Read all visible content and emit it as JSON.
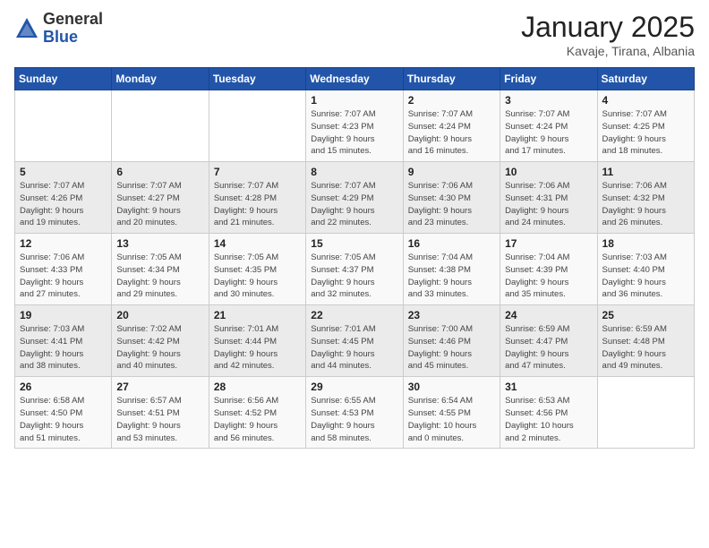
{
  "logo": {
    "general": "General",
    "blue": "Blue"
  },
  "header": {
    "month": "January 2025",
    "location": "Kavaje, Tirana, Albania"
  },
  "weekdays": [
    "Sunday",
    "Monday",
    "Tuesday",
    "Wednesday",
    "Thursday",
    "Friday",
    "Saturday"
  ],
  "weeks": [
    [
      {
        "day": "",
        "info": ""
      },
      {
        "day": "",
        "info": ""
      },
      {
        "day": "",
        "info": ""
      },
      {
        "day": "1",
        "info": "Sunrise: 7:07 AM\nSunset: 4:23 PM\nDaylight: 9 hours\nand 15 minutes."
      },
      {
        "day": "2",
        "info": "Sunrise: 7:07 AM\nSunset: 4:24 PM\nDaylight: 9 hours\nand 16 minutes."
      },
      {
        "day": "3",
        "info": "Sunrise: 7:07 AM\nSunset: 4:24 PM\nDaylight: 9 hours\nand 17 minutes."
      },
      {
        "day": "4",
        "info": "Sunrise: 7:07 AM\nSunset: 4:25 PM\nDaylight: 9 hours\nand 18 minutes."
      }
    ],
    [
      {
        "day": "5",
        "info": "Sunrise: 7:07 AM\nSunset: 4:26 PM\nDaylight: 9 hours\nand 19 minutes."
      },
      {
        "day": "6",
        "info": "Sunrise: 7:07 AM\nSunset: 4:27 PM\nDaylight: 9 hours\nand 20 minutes."
      },
      {
        "day": "7",
        "info": "Sunrise: 7:07 AM\nSunset: 4:28 PM\nDaylight: 9 hours\nand 21 minutes."
      },
      {
        "day": "8",
        "info": "Sunrise: 7:07 AM\nSunset: 4:29 PM\nDaylight: 9 hours\nand 22 minutes."
      },
      {
        "day": "9",
        "info": "Sunrise: 7:06 AM\nSunset: 4:30 PM\nDaylight: 9 hours\nand 23 minutes."
      },
      {
        "day": "10",
        "info": "Sunrise: 7:06 AM\nSunset: 4:31 PM\nDaylight: 9 hours\nand 24 minutes."
      },
      {
        "day": "11",
        "info": "Sunrise: 7:06 AM\nSunset: 4:32 PM\nDaylight: 9 hours\nand 26 minutes."
      }
    ],
    [
      {
        "day": "12",
        "info": "Sunrise: 7:06 AM\nSunset: 4:33 PM\nDaylight: 9 hours\nand 27 minutes."
      },
      {
        "day": "13",
        "info": "Sunrise: 7:05 AM\nSunset: 4:34 PM\nDaylight: 9 hours\nand 29 minutes."
      },
      {
        "day": "14",
        "info": "Sunrise: 7:05 AM\nSunset: 4:35 PM\nDaylight: 9 hours\nand 30 minutes."
      },
      {
        "day": "15",
        "info": "Sunrise: 7:05 AM\nSunset: 4:37 PM\nDaylight: 9 hours\nand 32 minutes."
      },
      {
        "day": "16",
        "info": "Sunrise: 7:04 AM\nSunset: 4:38 PM\nDaylight: 9 hours\nand 33 minutes."
      },
      {
        "day": "17",
        "info": "Sunrise: 7:04 AM\nSunset: 4:39 PM\nDaylight: 9 hours\nand 35 minutes."
      },
      {
        "day": "18",
        "info": "Sunrise: 7:03 AM\nSunset: 4:40 PM\nDaylight: 9 hours\nand 36 minutes."
      }
    ],
    [
      {
        "day": "19",
        "info": "Sunrise: 7:03 AM\nSunset: 4:41 PM\nDaylight: 9 hours\nand 38 minutes."
      },
      {
        "day": "20",
        "info": "Sunrise: 7:02 AM\nSunset: 4:42 PM\nDaylight: 9 hours\nand 40 minutes."
      },
      {
        "day": "21",
        "info": "Sunrise: 7:01 AM\nSunset: 4:44 PM\nDaylight: 9 hours\nand 42 minutes."
      },
      {
        "day": "22",
        "info": "Sunrise: 7:01 AM\nSunset: 4:45 PM\nDaylight: 9 hours\nand 44 minutes."
      },
      {
        "day": "23",
        "info": "Sunrise: 7:00 AM\nSunset: 4:46 PM\nDaylight: 9 hours\nand 45 minutes."
      },
      {
        "day": "24",
        "info": "Sunrise: 6:59 AM\nSunset: 4:47 PM\nDaylight: 9 hours\nand 47 minutes."
      },
      {
        "day": "25",
        "info": "Sunrise: 6:59 AM\nSunset: 4:48 PM\nDaylight: 9 hours\nand 49 minutes."
      }
    ],
    [
      {
        "day": "26",
        "info": "Sunrise: 6:58 AM\nSunset: 4:50 PM\nDaylight: 9 hours\nand 51 minutes."
      },
      {
        "day": "27",
        "info": "Sunrise: 6:57 AM\nSunset: 4:51 PM\nDaylight: 9 hours\nand 53 minutes."
      },
      {
        "day": "28",
        "info": "Sunrise: 6:56 AM\nSunset: 4:52 PM\nDaylight: 9 hours\nand 56 minutes."
      },
      {
        "day": "29",
        "info": "Sunrise: 6:55 AM\nSunset: 4:53 PM\nDaylight: 9 hours\nand 58 minutes."
      },
      {
        "day": "30",
        "info": "Sunrise: 6:54 AM\nSunset: 4:55 PM\nDaylight: 10 hours\nand 0 minutes."
      },
      {
        "day": "31",
        "info": "Sunrise: 6:53 AM\nSunset: 4:56 PM\nDaylight: 10 hours\nand 2 minutes."
      },
      {
        "day": "",
        "info": ""
      }
    ]
  ]
}
